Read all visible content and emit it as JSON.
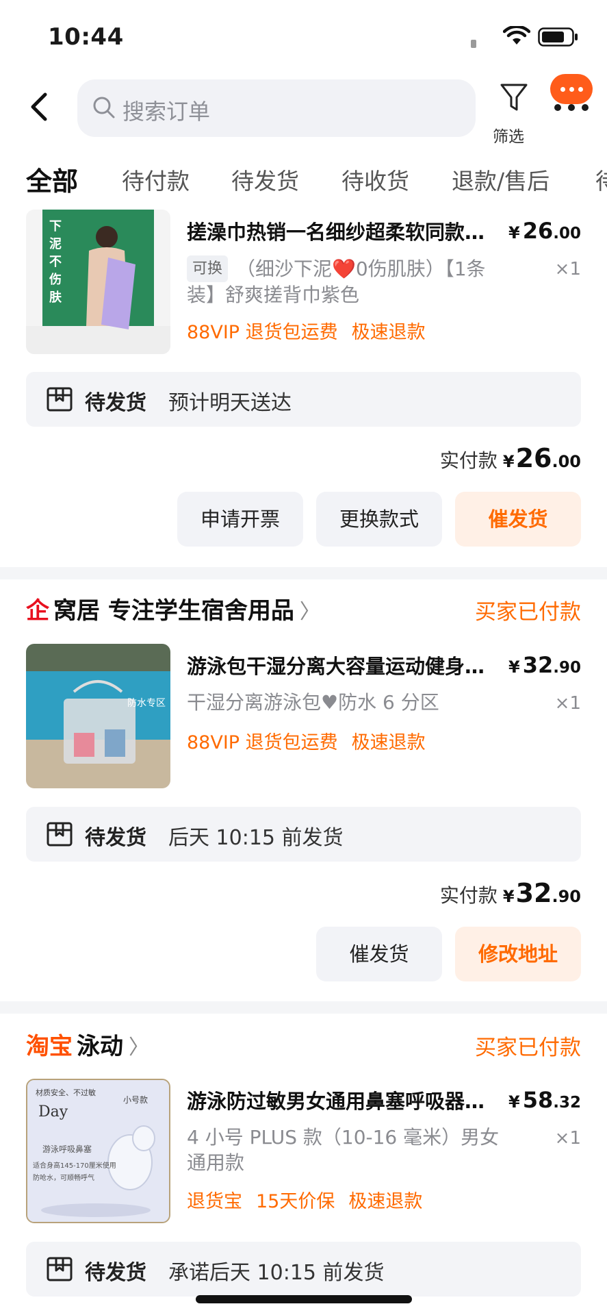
{
  "status_bar": {
    "time": "10:44"
  },
  "header": {
    "search_placeholder": "搜索订单",
    "filter_label": "筛选"
  },
  "tabs": [
    {
      "label": "全部",
      "active": true
    },
    {
      "label": "待付款"
    },
    {
      "label": "待发货"
    },
    {
      "label": "待收货"
    },
    {
      "label": "退款/售后"
    },
    {
      "label": "待"
    }
  ],
  "orders": [
    {
      "product_title": "搓澡巾热销一名细纱超柔软同款磨砂搓泥神器",
      "price_yen": "¥",
      "price_int": "26",
      "price_dec": ".00",
      "badge": "可换",
      "spec": "（细沙下泥❤️0伤肌肤）【1条装】舒爽搓背巾紫色",
      "qty": "×1",
      "tags": [
        "88VIP 退货包运费",
        "极速退款"
      ],
      "thumb_text": "下泥不伤肤",
      "ship_status": "待发货",
      "ship_desc": "预计明天送达",
      "paid_label": "实付款",
      "paid_int": "26",
      "paid_dec": ".00",
      "buttons": [
        "申请开票",
        "更换款式",
        "催发货"
      ]
    },
    {
      "shop_name": "窝居 专注学生宿舍用品",
      "shop_status": "买家已付款",
      "product_title": "游泳包干湿分离大容量运动健身收纳包",
      "price_int": "32",
      "price_dec": ".90",
      "spec": "干湿分离游泳包♥防水 6 分区",
      "qty": "×1",
      "tags": [
        "88VIP 退货包运费",
        "极速退款"
      ],
      "thumb_text": "防水专区",
      "ship_status": "待发货",
      "ship_desc": "后天 10:15 前发货",
      "paid_label": "实付款",
      "paid_int": "32",
      "paid_dec": ".90",
      "buttons": [
        "催发货",
        "修改地址"
      ]
    },
    {
      "shop_logo": "淘宝",
      "shop_name": "泳动",
      "shop_status": "买家已付款",
      "product_title": "游泳防过敏男女通用鼻塞呼吸器鼻夹",
      "price_int": "58",
      "price_dec": ".32",
      "spec": "4 小号 PLUS 款（10-16 毫米）男女通用款",
      "qty": "×1",
      "tags": [
        "退货宝",
        "15天价保",
        "极速退款"
      ],
      "thumb_lines": [
        "材质安全、不过敏",
        "小号款",
        "Day",
        "游泳呼吸鼻塞",
        "适合身高145-170厘米使用",
        "防呛水，可顺畅呼气"
      ],
      "ship_status": "待发货",
      "ship_desc": "承诺后天 10:15 前发货"
    }
  ],
  "colors": {
    "accent": "#ff6a00",
    "button_bg": "#f2f3f7",
    "primary_bg": "#fff0e6",
    "ship_bar": "#f3f4f7"
  }
}
